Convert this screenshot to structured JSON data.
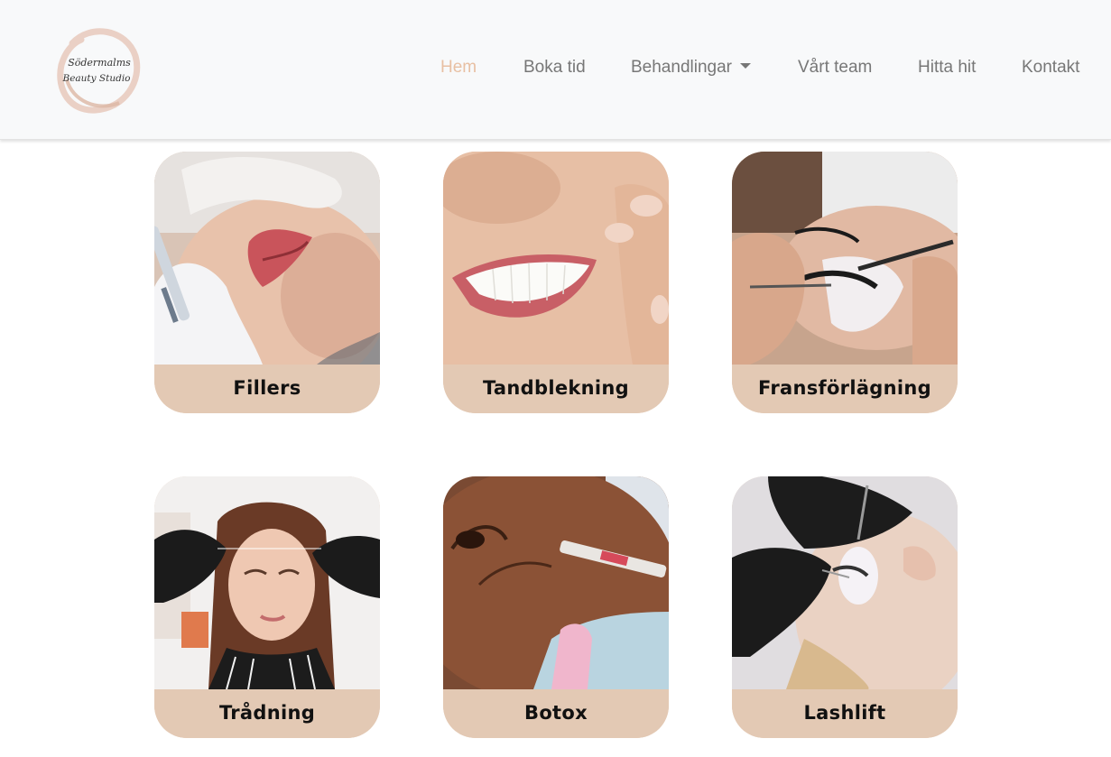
{
  "brand": {
    "logo_line1": "Södermalms",
    "logo_line2": "Beauty Studio"
  },
  "nav": {
    "items": [
      {
        "label": "Hem",
        "active": true
      },
      {
        "label": "Boka tid"
      },
      {
        "label": "Behandlingar",
        "dropdown": true
      },
      {
        "label": "Vårt team"
      },
      {
        "label": "Hitta hit"
      },
      {
        "label": "Kontakt"
      }
    ]
  },
  "treatments": [
    {
      "label": "Fillers",
      "photo": "lip-filler-injection"
    },
    {
      "label": "Tandblekning",
      "photo": "white-smile"
    },
    {
      "label": "Fransförlägning",
      "photo": "lash-extension-tweezers"
    },
    {
      "label": "Trådning",
      "photo": "eyebrow-threading"
    },
    {
      "label": "Botox",
      "photo": "forehead-injection"
    },
    {
      "label": "Lashlift",
      "photo": "lash-lift-gloves"
    }
  ],
  "colors": {
    "accent": "#e8c0a3",
    "card_label_bg": "#e3c9b4",
    "nav_bg": "#f8f9fa",
    "nav_text": "#777777"
  }
}
